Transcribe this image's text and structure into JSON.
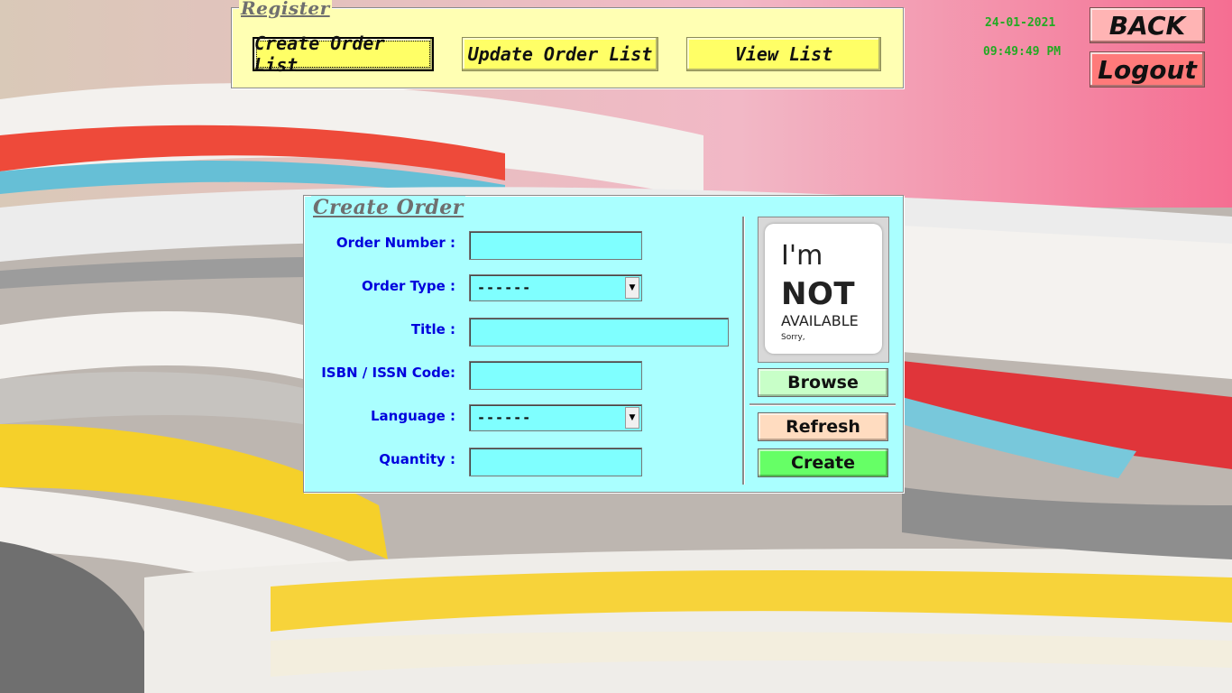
{
  "register": {
    "title": "Register",
    "buttons": {
      "create": "Create Order List",
      "update": "Update Order List",
      "view": "View List"
    }
  },
  "clock": {
    "date": "24-01-2021",
    "time": "09:49:49 PM"
  },
  "nav": {
    "back": "BACK",
    "logout": "Logout"
  },
  "create_order": {
    "title": "Create Order",
    "fields": {
      "order_number": {
        "label": "Order Number :",
        "value": ""
      },
      "order_type": {
        "label": "Order Type :",
        "value": "------"
      },
      "title": {
        "label": "Title :",
        "value": ""
      },
      "isbn": {
        "label": "ISBN / ISSN Code:",
        "value": ""
      },
      "language": {
        "label": "Language :",
        "value": "------"
      },
      "quantity": {
        "label": "Quantity :",
        "value": ""
      }
    },
    "image_placeholder": {
      "line1": "I'm",
      "line2": "NOT",
      "line3": "AVAILABLE",
      "line4": "Sorry,"
    },
    "buttons": {
      "browse": "Browse",
      "refresh": "Refresh",
      "create": "Create"
    }
  },
  "colors": {
    "register_bg": "#ffffb3",
    "register_button": "#ffff66",
    "order_panel_bg": "#aaffff",
    "input_bg": "#7fffff",
    "label_blue": "#0000dd",
    "clock_green": "#22aa22",
    "back_button": "#ffb4b4",
    "logout_button": "#ff7a7a",
    "browse_button": "#c8ffc8",
    "refresh_button": "#ffdcc0",
    "create_button": "#66ff66"
  }
}
